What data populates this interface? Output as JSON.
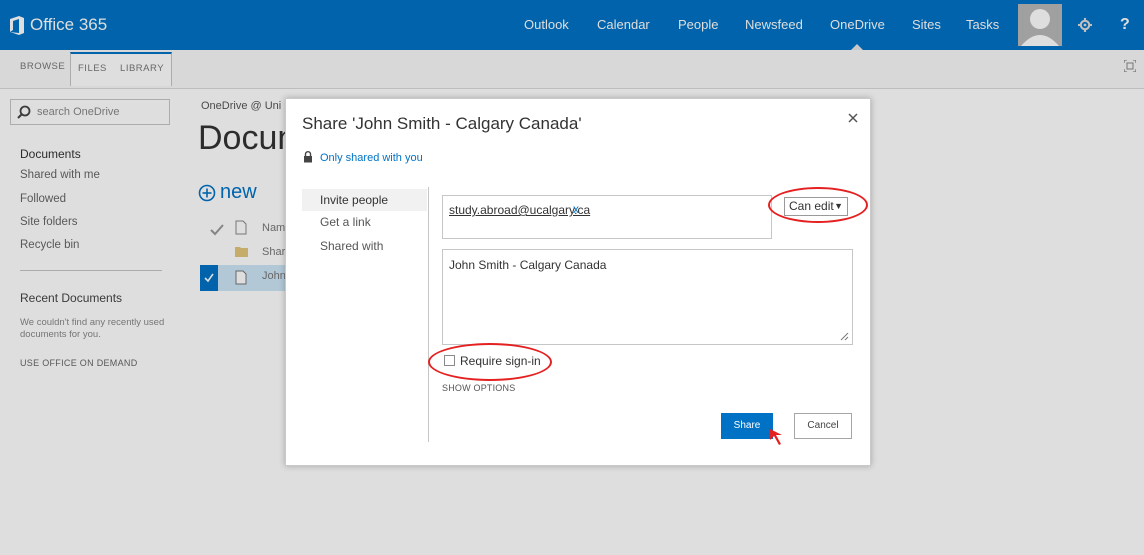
{
  "topbar": {
    "brand": "Office 365",
    "nav": [
      {
        "label": "Outlook"
      },
      {
        "label": "Calendar"
      },
      {
        "label": "People"
      },
      {
        "label": "Newsfeed"
      },
      {
        "label": "OneDrive",
        "active": true
      },
      {
        "label": "Sites"
      },
      {
        "label": "Tasks"
      }
    ],
    "settings_icon": "gear-icon",
    "help_label": "?"
  },
  "ribbon": {
    "tabs": [
      {
        "label": "BROWSE"
      },
      {
        "label": "FILES",
        "active": true
      },
      {
        "label": "LIBRARY"
      }
    ]
  },
  "sidebar": {
    "search_placeholder": "search OneDrive",
    "links": [
      {
        "label": "Documents",
        "active": true
      },
      {
        "label": "Shared with me"
      },
      {
        "label": "Followed"
      },
      {
        "label": "Site folders"
      },
      {
        "label": "Recycle bin"
      }
    ],
    "recent_heading": "Recent Documents",
    "recent_note": "We couldn't find any recently used documents for you.",
    "on_demand": "USE OFFICE ON DEMAND"
  },
  "main": {
    "breadcrumb": "OneDrive @ Uni",
    "title": "Docun",
    "new_label": "new",
    "rows": [
      {
        "text": "Nam"
      },
      {
        "text": "Shar"
      },
      {
        "text": "John"
      }
    ]
  },
  "dialog": {
    "title": "Share 'John Smith - Calgary Canada'",
    "shared_status": "Only shared with you",
    "tabs": [
      {
        "label": "Invite people",
        "active": true
      },
      {
        "label": "Get a link"
      },
      {
        "label": "Shared with"
      }
    ],
    "recipient": "study.abroad@ucalgary.ca",
    "recipient_remove": "x",
    "permission": "Can edit",
    "message": "John Smith - Calgary Canada",
    "require_signin_label": "Require sign-in",
    "require_signin_checked": false,
    "show_options": "SHOW OPTIONS",
    "share_label": "Share",
    "cancel_label": "Cancel"
  },
  "colors": {
    "brand_blue": "#0072c6",
    "annotation_red": "#e52020"
  }
}
